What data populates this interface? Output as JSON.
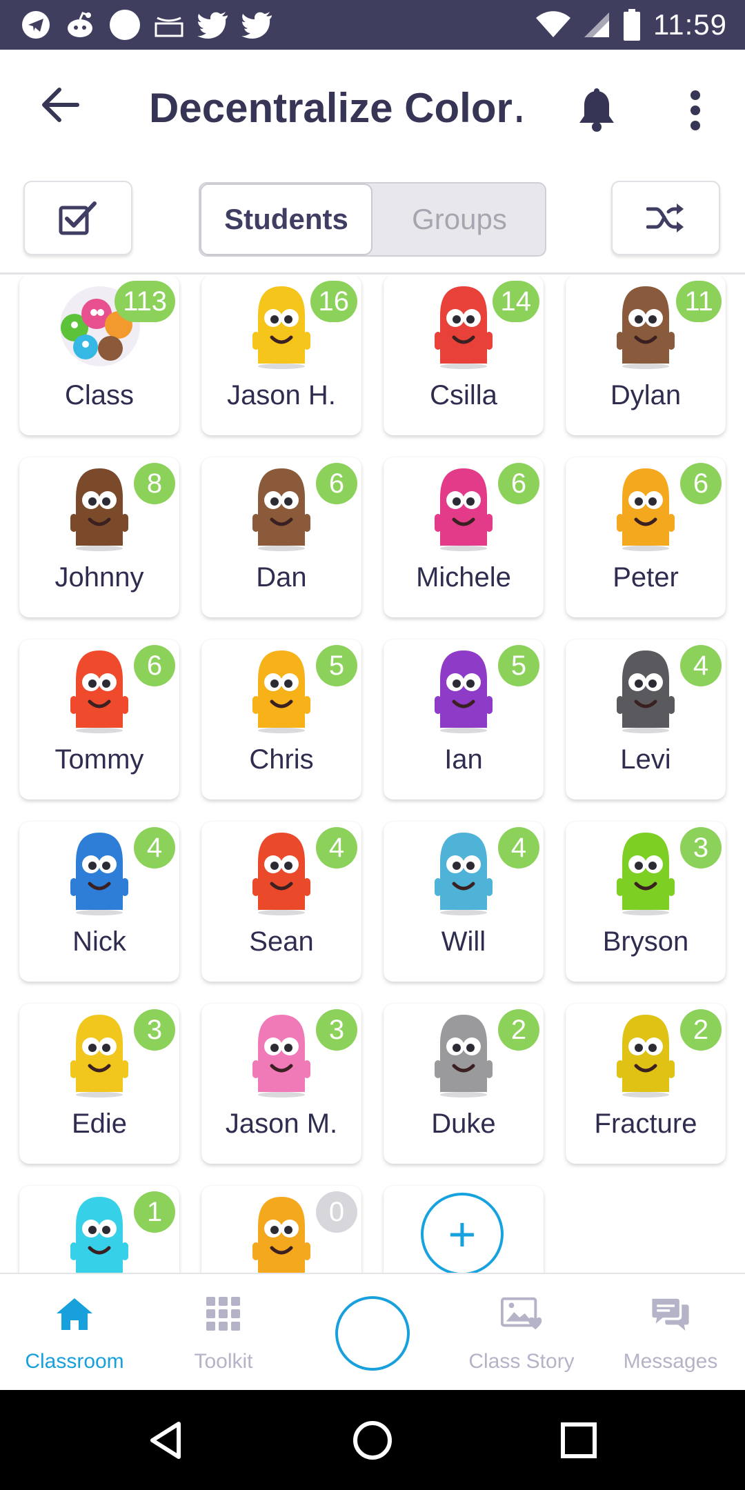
{
  "status_bar": {
    "time": "11:59",
    "left_icons": [
      "telegram-icon",
      "reddit-icon",
      "circle-icon",
      "amazon-icon",
      "twitter-icon",
      "twitter-icon"
    ],
    "right_icons": [
      "wifi-icon",
      "signal-icon",
      "battery-icon"
    ]
  },
  "app_bar": {
    "title": "Decentralize Color…",
    "back_icon": "arrow-left-icon",
    "bell_icon": "bell-icon",
    "more_icon": "more-vert-icon"
  },
  "toolbar": {
    "select_icon": "checkbox-icon",
    "shuffle_icon": "shuffle-icon",
    "tabs": [
      {
        "label": "Students",
        "active": true
      },
      {
        "label": "Groups",
        "active": false
      }
    ]
  },
  "colors": {
    "accent": "#18a0dc",
    "badge": "#8cd15a",
    "badge_zero": "#d7d7db",
    "status_bar": "#3f3e5e"
  },
  "students": [
    {
      "name": "Class",
      "points": "113",
      "avatar": "class-group",
      "color": "#e84f8f"
    },
    {
      "name": "Jason H.",
      "points": "16",
      "avatar": "monster",
      "color": "#f5c51b"
    },
    {
      "name": "Csilla",
      "points": "14",
      "avatar": "monster",
      "color": "#e8413a"
    },
    {
      "name": "Dylan",
      "points": "11",
      "avatar": "monster",
      "color": "#8a5a3c"
    },
    {
      "name": "Johnny",
      "points": "8",
      "avatar": "monster",
      "color": "#7a4a2a"
    },
    {
      "name": "Dan",
      "points": "6",
      "avatar": "monster",
      "color": "#8b5a3a"
    },
    {
      "name": "Michele",
      "points": "6",
      "avatar": "monster",
      "color": "#e33a8a"
    },
    {
      "name": "Peter",
      "points": "6",
      "avatar": "monster",
      "color": "#f4a81e"
    },
    {
      "name": "Tommy",
      "points": "6",
      "avatar": "monster",
      "color": "#f04a2c"
    },
    {
      "name": "Chris",
      "points": "5",
      "avatar": "monster",
      "color": "#f7b21a"
    },
    {
      "name": "Ian",
      "points": "5",
      "avatar": "monster",
      "color": "#8e3cc8"
    },
    {
      "name": "Levi",
      "points": "4",
      "avatar": "monster",
      "color": "#5a5a5e"
    },
    {
      "name": "Nick",
      "points": "4",
      "avatar": "monster",
      "color": "#2e7ed8"
    },
    {
      "name": "Sean",
      "points": "4",
      "avatar": "monster",
      "color": "#ea4a2a"
    },
    {
      "name": "Will",
      "points": "4",
      "avatar": "monster",
      "color": "#4fb3d8"
    },
    {
      "name": "Bryson",
      "points": "3",
      "avatar": "monster",
      "color": "#7dcf23"
    },
    {
      "name": "Edie",
      "points": "3",
      "avatar": "monster",
      "color": "#f1c61d"
    },
    {
      "name": "Jason M.",
      "points": "3",
      "avatar": "monster",
      "color": "#f07ab8"
    },
    {
      "name": "Duke",
      "points": "2",
      "avatar": "monster",
      "color": "#9a9a9c"
    },
    {
      "name": "Fracture",
      "points": "2",
      "avatar": "monster",
      "color": "#e0c214"
    },
    {
      "name": "",
      "points": "1",
      "avatar": "monster",
      "color": "#36d0e8"
    },
    {
      "name": "",
      "points": "0",
      "avatar": "monster",
      "color": "#f4a81e"
    }
  ],
  "add_student": {
    "label": "+"
  },
  "bottom_nav": [
    {
      "label": "Classroom",
      "icon": "home-icon",
      "active": true
    },
    {
      "label": "Toolkit",
      "icon": "grid-icon",
      "active": false
    },
    {
      "label": "",
      "icon": "camera-circle-icon",
      "active": false
    },
    {
      "label": "Class Story",
      "icon": "photo-heart-icon",
      "active": false
    },
    {
      "label": "Messages",
      "icon": "chat-icon",
      "active": false
    }
  ],
  "android_nav": [
    "back-triangle-icon",
    "home-circle-icon",
    "recents-square-icon"
  ]
}
